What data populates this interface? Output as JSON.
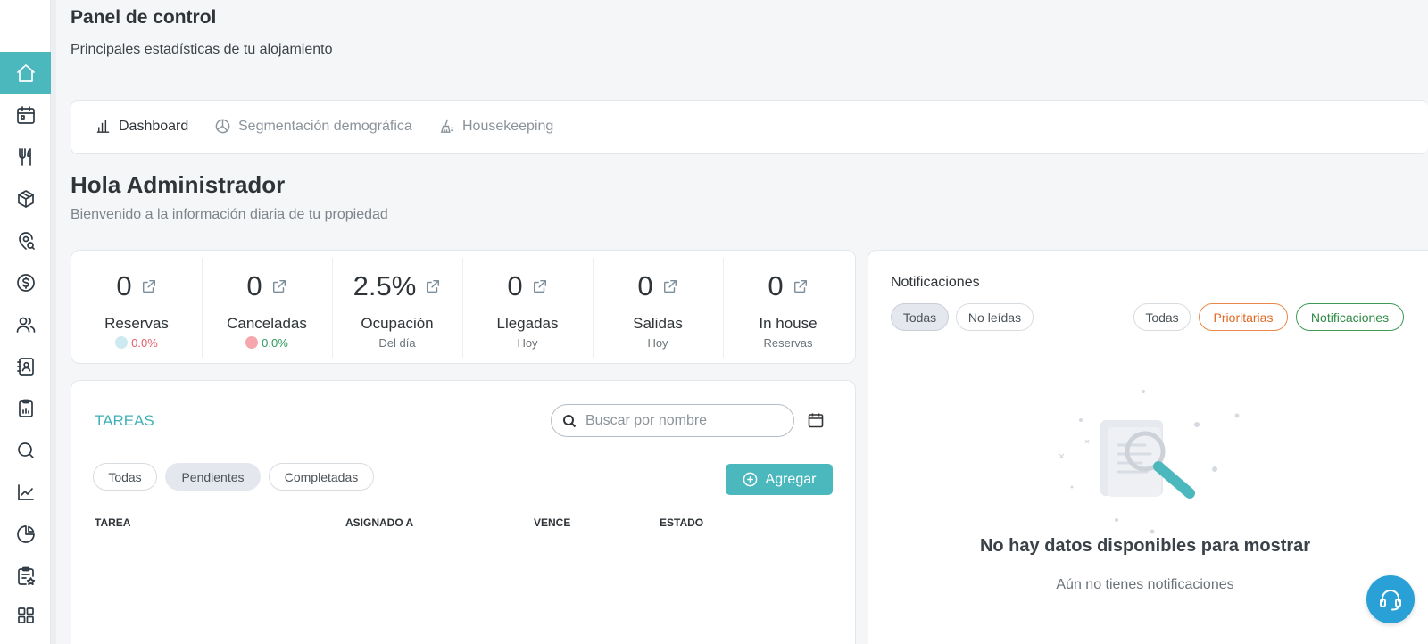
{
  "header": {
    "title": "Panel de control",
    "subtitle": "Principales estadísticas de tu alojamiento"
  },
  "sidebar": {
    "items": [
      {
        "icon": "home-icon",
        "active": true
      },
      {
        "icon": "calendar-icon"
      },
      {
        "icon": "restaurant-icon"
      },
      {
        "icon": "package-icon"
      },
      {
        "icon": "location-search-icon"
      },
      {
        "icon": "dollar-icon"
      },
      {
        "icon": "users-icon"
      },
      {
        "icon": "contacts-icon"
      },
      {
        "icon": "clipboard-report-icon"
      },
      {
        "icon": "search-icon"
      },
      {
        "icon": "line-chart-icon"
      },
      {
        "icon": "pie-chart-icon"
      },
      {
        "icon": "clipboard-star-icon"
      },
      {
        "icon": "apps-grid-icon"
      }
    ]
  },
  "tabs": [
    {
      "label": "Dashboard",
      "icon": "bar-chart-icon",
      "active": true
    },
    {
      "label": "Segmentación demográfica",
      "icon": "pie-chart-icon"
    },
    {
      "label": "Housekeeping",
      "icon": "broom-icon"
    }
  ],
  "greeting": {
    "title": "Hola Administrador",
    "subtitle": "Bienvenido a la información diaria de tu propiedad"
  },
  "stats": [
    {
      "value": "0",
      "label": "Reservas",
      "pct": "0.0%",
      "pct_color": "#e35d6a"
    },
    {
      "value": "0",
      "label": "Canceladas",
      "pct": "0.0%",
      "pct_color": "#2f9a5a"
    },
    {
      "value": "2.5%",
      "label": "Ocupación",
      "sub": "Del día"
    },
    {
      "value": "0",
      "label": "Llegadas",
      "sub": "Hoy"
    },
    {
      "value": "0",
      "label": "Salidas",
      "sub": "Hoy"
    },
    {
      "value": "0",
      "label": "In house",
      "sub": "Reservas"
    }
  ],
  "tasks": {
    "title": "TAREAS",
    "search_placeholder": "Buscar por nombre",
    "filters": [
      "Todas",
      "Pendientes",
      "Completadas"
    ],
    "selected_filter": "Pendientes",
    "add_label": "Agregar",
    "columns": [
      "TAREA",
      "ASIGNADO A",
      "VENCE",
      "ESTADO"
    ]
  },
  "notifications": {
    "title": "Notificaciones",
    "read_filters": [
      "Todas",
      "No leídas"
    ],
    "type_filters": [
      "Todas",
      "Prioritarias",
      "Notificaciones"
    ],
    "empty_title": "No hay datos disponibles para mostrar",
    "empty_subtitle": "Aún no tienes notificaciones"
  },
  "colors": {
    "accent": "#4bb8be",
    "support": "#2aa1d6",
    "priority": "#e06a24",
    "notif_green": "#2f8a45"
  }
}
